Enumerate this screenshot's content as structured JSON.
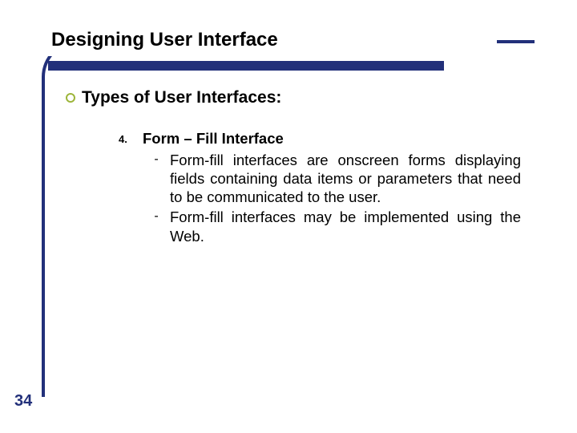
{
  "slide": {
    "title": "Designing User Interface",
    "subhead": "Types of User Interfaces:",
    "list": {
      "number": "4.",
      "heading": "Form – Fill Interface",
      "points": [
        "Form-fill interfaces are onscreen forms displaying fields containing data items or parameters that need to be communicated to the user.",
        "Form-fill interfaces may be implemented using the Web."
      ]
    },
    "page_number": "34"
  },
  "colors": {
    "accent": "#22307a",
    "bullet_ring": "#9db53a"
  }
}
